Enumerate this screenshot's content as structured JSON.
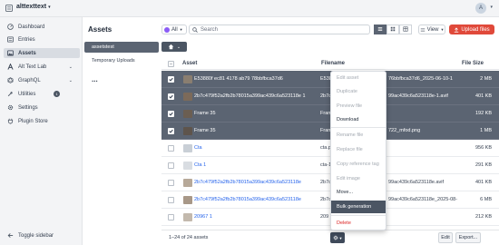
{
  "topbar": {
    "site_name": "alttexttext",
    "avatar_letter": "A"
  },
  "sidebar": {
    "items": [
      {
        "label": "Dashboard"
      },
      {
        "label": "Entries"
      },
      {
        "label": "Assets"
      },
      {
        "label": "Alt Text Lab"
      },
      {
        "label": "GraphQL"
      },
      {
        "label": "Utilities",
        "badge": "1"
      },
      {
        "label": "Settings"
      },
      {
        "label": "Plugin Store"
      }
    ],
    "toggle_label": "Toggle sidebar"
  },
  "header": {
    "title": "Assets",
    "source_filter": "All",
    "search_placeholder": "Search",
    "view_label": "View",
    "upload_label": "Upload files"
  },
  "folders": [
    {
      "label": "assetstest"
    },
    {
      "label": "Temporary Uploads"
    },
    {
      "label": "..."
    }
  ],
  "table": {
    "columns": {
      "asset": "Asset",
      "filename": "Filename",
      "filesize": "File Size"
    },
    "rows": [
      {
        "asset": "E53880f ec81 4178 ab79 78bbfbca37d6",
        "filename": "76bbfbca37d6_2025-06-10-1",
        "filename_pre": "E53880",
        "size": "2 MB",
        "selected": true,
        "thumb": "#8a7e70"
      },
      {
        "asset": "2b7c479f52a2fb2b78015a399ac439c6a523118e 1",
        "filename": "99ac439c6a523118e-1.avif",
        "filename_pre": "2b7c47",
        "size": "401 KB",
        "selected": true,
        "thumb": "#7c6a5a"
      },
      {
        "asset": "Frame 35",
        "filename": "",
        "filename_pre": "Frame",
        "size": "192 KB",
        "selected": true,
        "thumb": "#6b5e52"
      },
      {
        "asset": "Frame 35",
        "filename": "722_mfod.png",
        "filename_pre": "Frame",
        "size": "1 MB",
        "selected": true,
        "thumb": "#5e544c"
      },
      {
        "asset": "Cta",
        "filename": "",
        "filename_pre": "cta.p",
        "size": "956 KB",
        "selected": false,
        "thumb": "#c9cfd6"
      },
      {
        "asset": "Cta 1",
        "filename": "",
        "filename_pre": "cta-1",
        "size": "291 KB",
        "selected": false,
        "thumb": "#d9dde2"
      },
      {
        "asset": "2b7c479f52a2fb2b78015a399ac439c6a523118e",
        "filename": "99ac439c6a523118e.avif",
        "filename_pre": "2b7c4",
        "size": "401 KB",
        "selected": false,
        "thumb": "#b7a999"
      },
      {
        "asset": "2b7c479f52a2fb2b78015a399ac439c6a523118e",
        "filename": "99ac439c6a523118e_2025-08-",
        "filename_pre": "2b7c4",
        "size": "6 MB",
        "selected": false,
        "thumb": "#a89888"
      },
      {
        "asset": "20967 1",
        "filename": "",
        "filename_pre": "209",
        "size": "212 KB",
        "selected": false,
        "thumb": "#c3b9ad"
      }
    ]
  },
  "footer": {
    "count": "1–24 of 24 assets",
    "edit_label": "Edit",
    "export_label": "Export..."
  },
  "context_menu": {
    "items": [
      {
        "label": "Edit asset",
        "state": "disabled"
      },
      {
        "label": "Duplicate",
        "state": "disabled"
      },
      {
        "label": "Preview file",
        "state": "disabled"
      },
      {
        "label": "Download",
        "state": "normal"
      },
      {
        "label": "Rename file",
        "state": "disabled"
      },
      {
        "label": "Replace file",
        "state": "disabled"
      },
      {
        "label": "Copy reference tag",
        "state": "disabled"
      },
      {
        "label": "Edit image",
        "state": "disabled"
      },
      {
        "label": "Move...",
        "state": "normal"
      },
      {
        "label": "Bulk generation",
        "state": "highlighted"
      },
      {
        "label": "Delete",
        "state": "danger"
      }
    ]
  },
  "colors": {
    "selected_row": "#5b6472",
    "accent_upload": "#e0493a",
    "link": "#2563eb",
    "danger": "#dc2626"
  }
}
